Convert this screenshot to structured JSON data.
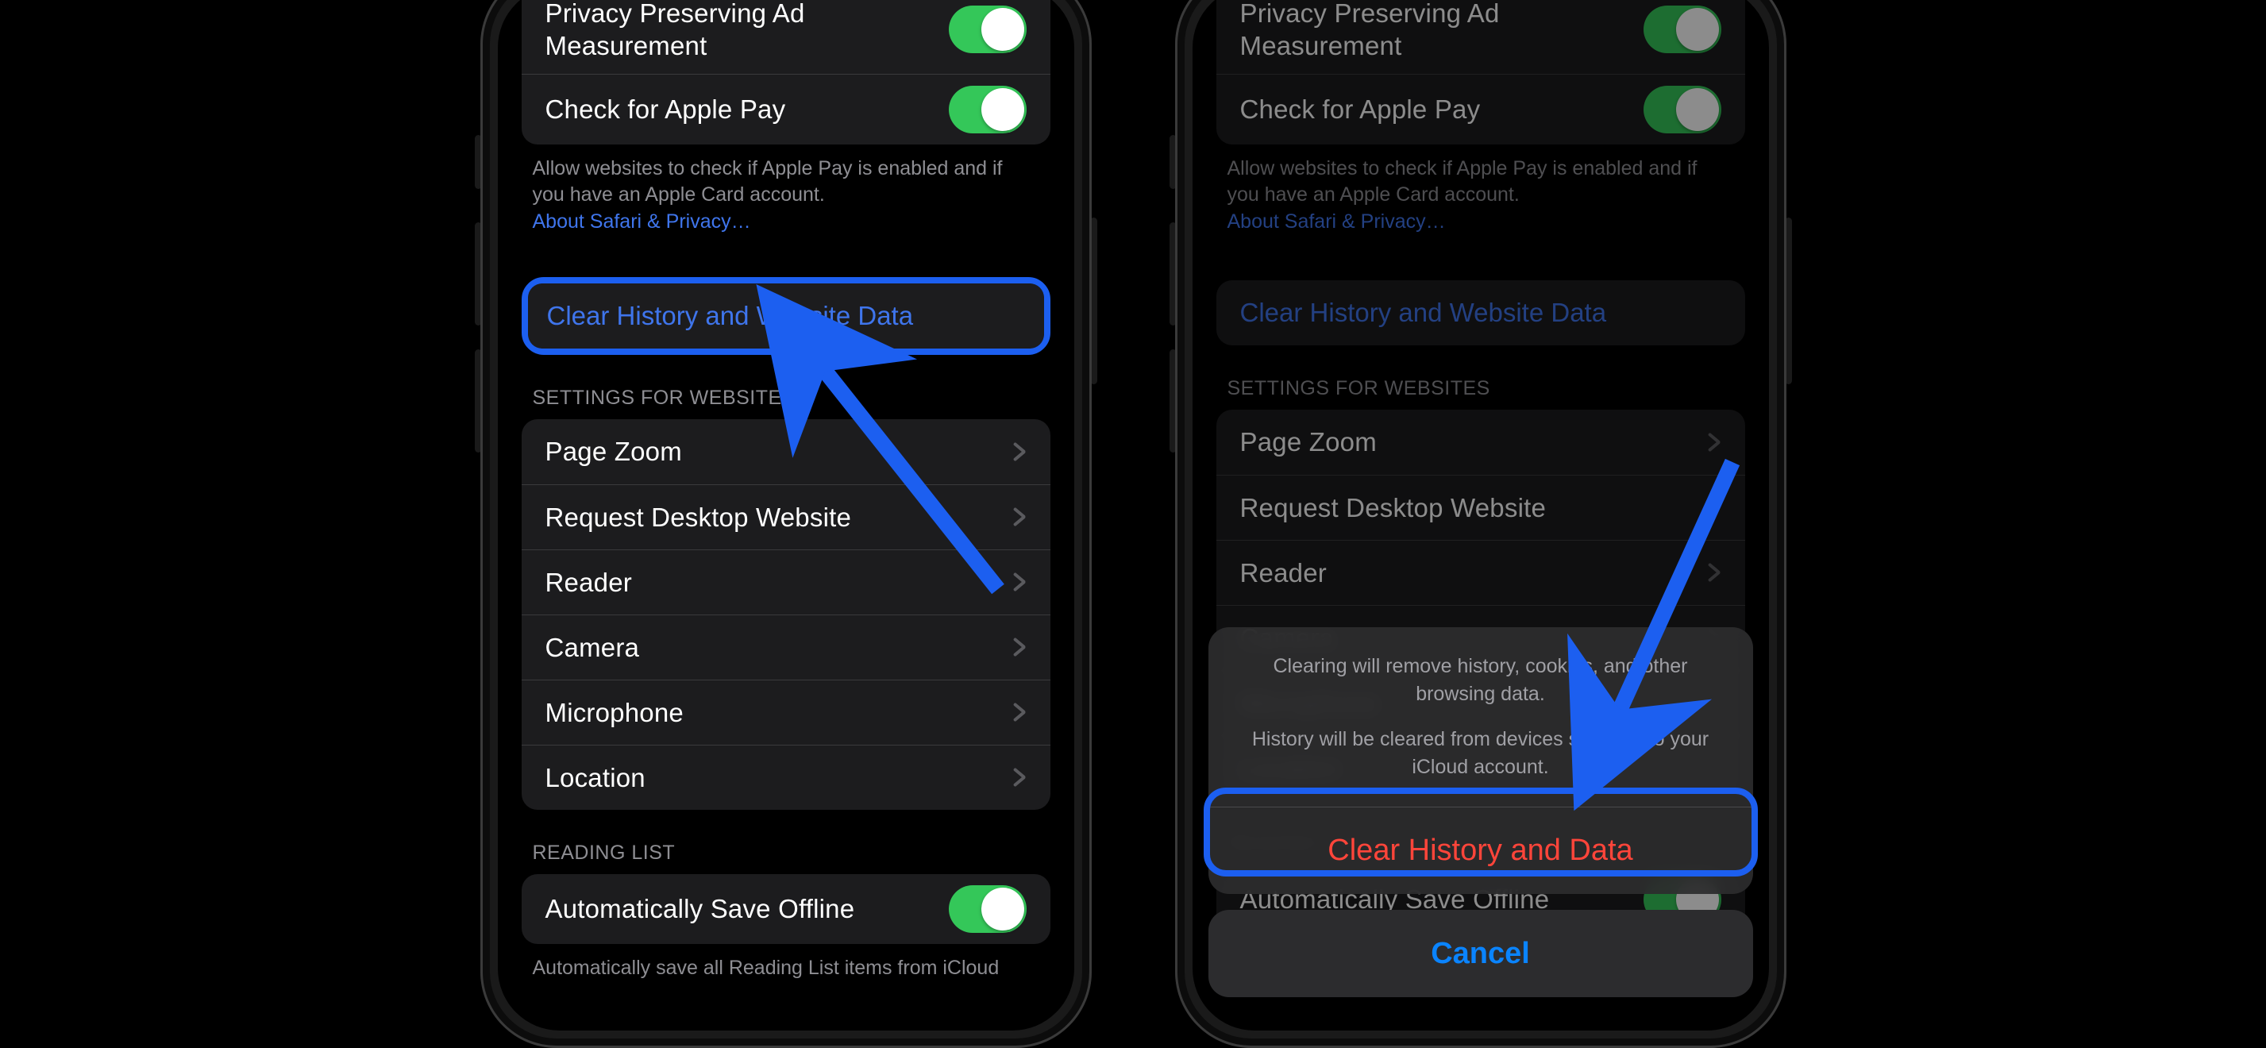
{
  "privacy_group": {
    "items": [
      {
        "label": "Privacy Preserving Ad Measurement",
        "toggle": true
      },
      {
        "label": "Check for Apple Pay",
        "toggle": true
      }
    ],
    "footer": "Allow websites to check if Apple Pay is enabled and if you have an Apple Card account.",
    "footer_link": "About Safari & Privacy…"
  },
  "clear_row": {
    "label": "Clear History and Website Data"
  },
  "websites_section": {
    "header": "SETTINGS FOR WEBSITES",
    "items": [
      {
        "label": "Page Zoom"
      },
      {
        "label": "Request Desktop Website"
      },
      {
        "label": "Reader"
      },
      {
        "label": "Camera"
      },
      {
        "label": "Microphone"
      },
      {
        "label": "Location"
      }
    ]
  },
  "reading_list_section": {
    "header": "READING LIST",
    "item": {
      "label": "Automatically Save Offline",
      "toggle": true
    },
    "footer": "Automatically save all Reading List items from iCloud"
  },
  "action_sheet": {
    "msg1": "Clearing will remove history, cookies, and other browsing data.",
    "msg2": "History will be cleared from devices signed into your iCloud account.",
    "destructive": "Clear History and Data",
    "cancel": "Cancel"
  }
}
